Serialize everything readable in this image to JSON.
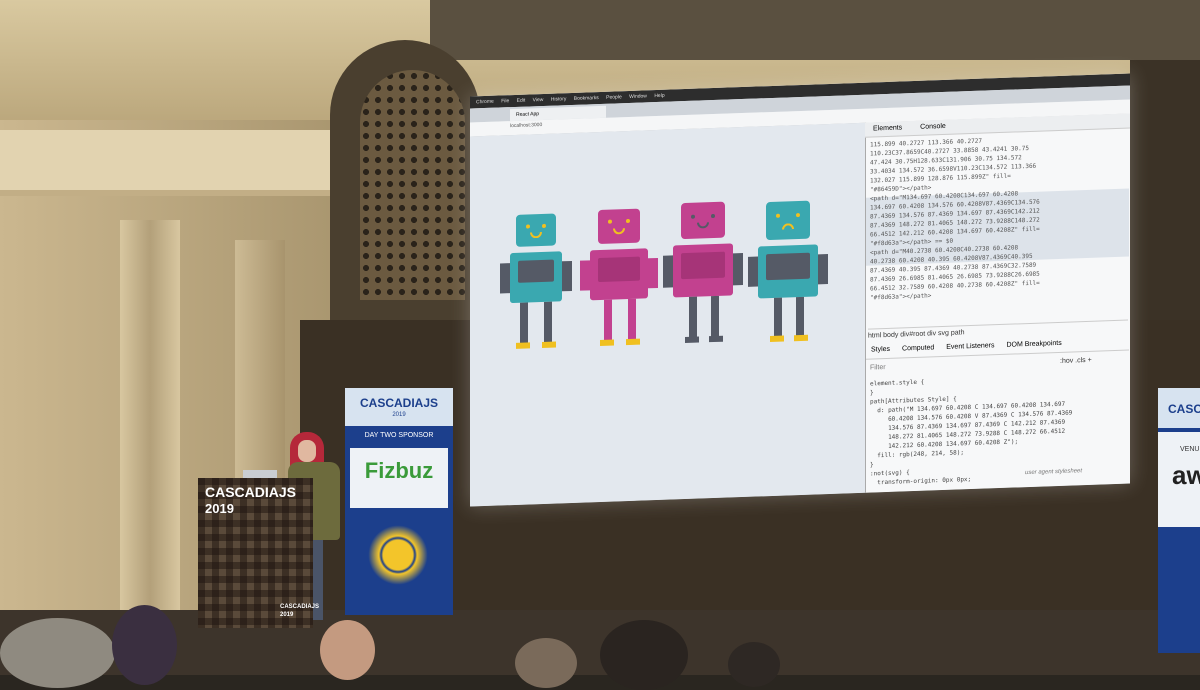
{
  "screen": {
    "menubar": [
      "Chrome",
      "File",
      "Edit",
      "View",
      "History",
      "Bookmarks",
      "People",
      "Window",
      "Help"
    ],
    "tab_title": "React App",
    "url": "localhost:3000",
    "devtools": {
      "tabs": [
        "Elements",
        "Console"
      ],
      "code_top": "115.899 40.2727 113.366 40.2727\n110.23C37.8659C40.2727 33.8858 43.4241 30.75\n47.424 30.75H128.633C131.906 30.75 134.572\n33.4034 134.572 36.6598V110.23C134.572 113.366\n132.027 115.899 128.876 115.899Z\" fill=\n\"#86459D\"></path>\n<path d=\"M134.697 60.4208C134.697 60.4208\n134.697 60.4208 134.576 60.4208V87.4369C134.576\n87.4369 134.576 87.4369 134.697 87.4369C142.212\n87.4369 148.272 81.4065 148.272 73.9288C148.272\n66.4512 142.212 60.4208 134.697 60.4208Z\" fill=\n\"#f8d63a\"></path> == $0\n<path d=\"M40.2738 60.4208C40.2738 60.4208\n40.2738 60.4208 40.395 60.4208V87.4369C40.395\n87.4369 40.395 87.4369 40.2738 87.4369C32.7589\n87.4369 26.6985 81.4065 26.6985 73.9288C26.6985\n66.4512 32.7589 60.4208 40.2738 60.4208Z\" fill=\n\"#f8d63a\"></path>",
      "breadcrumbs": "html  body  div#root  div  svg  path",
      "style_tabs": [
        "Styles",
        "Computed",
        "Event Listeners",
        "DOM Breakpoints"
      ],
      "filter_placeholder": "Filter",
      "filter_right": ":hov  .cls  +",
      "code_styles": "element.style {\n}\npath[Attributes Style] {\n  d: path(\"M 134.697 60.4208 C 134.697 60.4208 134.697\n     60.4208 134.576 60.4208 V 87.4369 C 134.576 87.4369\n     134.576 87.4369 134.697 87.4369 C 142.212 87.4369\n     148.272 81.4065 148.272 73.9288 C 148.272 66.4512\n     142.212 60.4208 134.697 60.4208 Z\");\n  fill: rgb(248, 214, 58);\n}\n:not(svg) {\n  transform-origin: 0px 0px;",
      "user_agent_label": "user agent stylesheet"
    }
  },
  "banner_left": {
    "title": "CASCADIAJS",
    "year": "2019",
    "sponsor_label": "DAY TWO SPONSOR",
    "sponsor_name": "Fizbuz"
  },
  "banner_right": {
    "title": "CASCA",
    "venue": "VENU",
    "logo": "aw"
  },
  "podium": {
    "title": "CASCADIAJS",
    "year": "2019",
    "title_small": "CASCADIAJS",
    "year_small": "2019"
  },
  "colors": {
    "robot_teal": "#3aa8b0",
    "robot_pink": "#c2418f",
    "robot_purple": "#86459d",
    "robot_yellow": "#f8d63a",
    "banner_blue": "#1c3f8c"
  }
}
